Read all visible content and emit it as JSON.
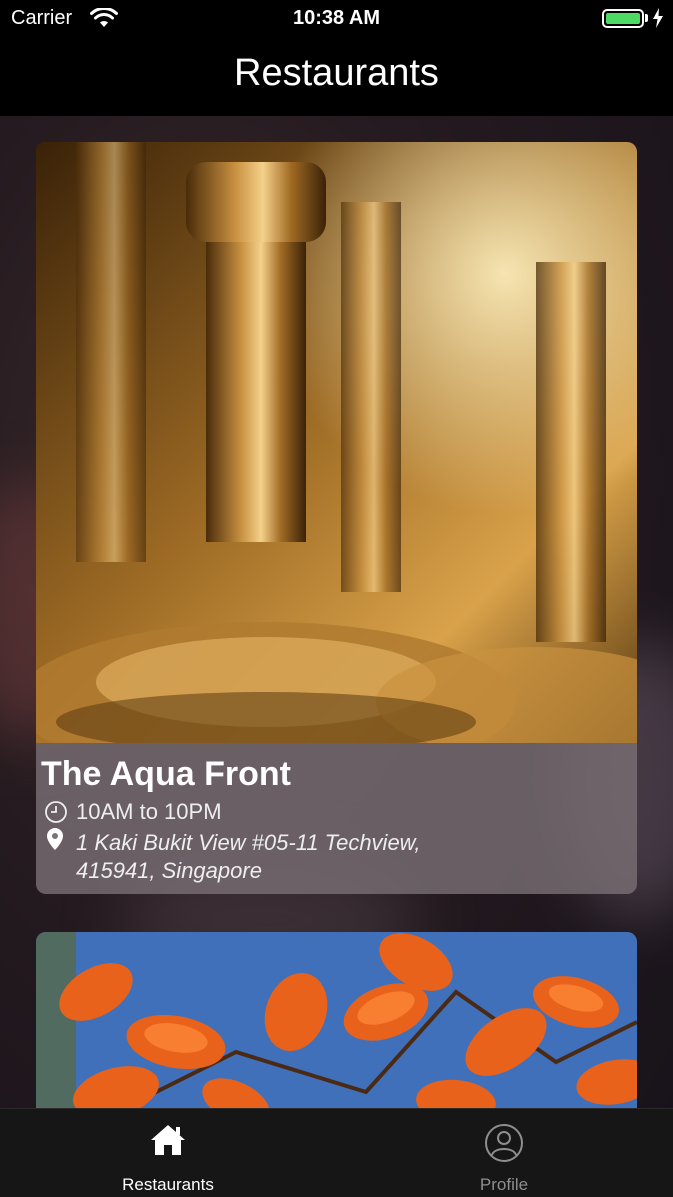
{
  "status_bar": {
    "carrier": "Carrier",
    "time": "10:38 AM",
    "battery_level": 1.0
  },
  "nav": {
    "title": "Restaurants"
  },
  "restaurants": [
    {
      "name": "The Aqua Front",
      "hours": "10AM to 10PM",
      "address": "1 Kaki Bukit View #05-11 Techview, 415941, Singapore",
      "image": "wine-glasses-photo"
    },
    {
      "image": "orange-leaves-photo"
    }
  ],
  "tabs": [
    {
      "label": "Restaurants",
      "icon": "home-icon",
      "active": true
    },
    {
      "label": "Profile",
      "icon": "profile-icon",
      "active": false
    }
  ],
  "colors": {
    "accent_active": "#ffffff",
    "inactive": "#8e8e8e",
    "battery_green": "#4cd964"
  }
}
